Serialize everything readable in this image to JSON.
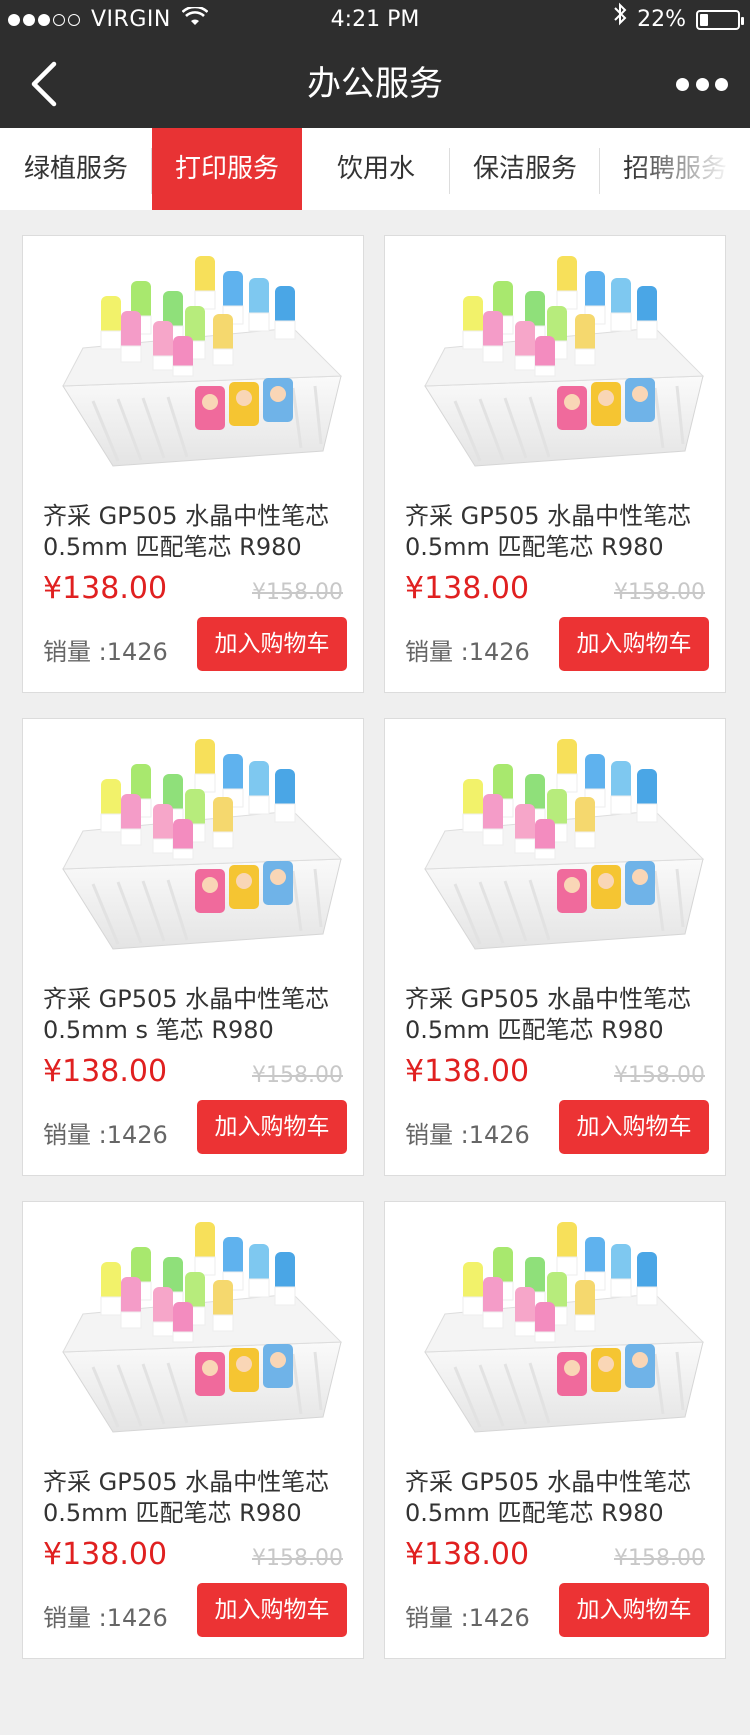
{
  "status_bar": {
    "carrier": "VIRGIN",
    "time": "4:21 PM",
    "battery": "22%",
    "battery_level": 0.22,
    "icons": [
      "signal-dots-icon",
      "wifi-icon",
      "bluetooth-icon",
      "battery-icon"
    ]
  },
  "nav": {
    "title": "办公服务",
    "back_icon": "chevron-left-icon",
    "more_icon": "more-dots-icon"
  },
  "tabs": [
    {
      "label": "绿植服务",
      "active": false
    },
    {
      "label": "打印服务",
      "active": true
    },
    {
      "label": "饮用水",
      "active": false
    },
    {
      "label": "保洁服务",
      "active": false
    },
    {
      "label": "招聘服务",
      "active": false
    }
  ],
  "colors": {
    "nav_bg": "#2e2e2e",
    "accent": "#e83334",
    "price": "#e02020",
    "page_bg": "#efefef"
  },
  "products": [
    {
      "name": "齐采 GP505 水晶中性笔芯 0.5mm 匹配笔芯 R980",
      "price": "¥138.00",
      "original_price": "¥158.00",
      "sales": "销量 :1426",
      "button": "加入购物车"
    },
    {
      "name": "齐采 GP505 水晶中性笔芯 0.5mm 匹配笔芯 R980",
      "price": "¥138.00",
      "original_price": "¥158.00",
      "sales": "销量 :1426",
      "button": "加入购物车"
    },
    {
      "name": "齐采 GP505 水晶中性笔芯 0.5mm s 笔芯 R980",
      "price": "¥138.00",
      "original_price": "¥158.00",
      "sales": "销量 :1426",
      "button": "加入购物车"
    },
    {
      "name": "齐采 GP505 水晶中性笔芯 0.5mm 匹配笔芯 R980",
      "price": "¥138.00",
      "original_price": "¥158.00",
      "sales": "销量 :1426",
      "button": "加入购物车"
    },
    {
      "name": "齐采 GP505 水晶中性笔芯 0.5mm 匹配笔芯 R980",
      "price": "¥138.00",
      "original_price": "¥158.00",
      "sales": "销量 :1426",
      "button": "加入购物车"
    },
    {
      "name": "齐采 GP505 水晶中性笔芯 0.5mm 匹配笔芯 R980",
      "price": "¥138.00",
      "original_price": "¥158.00",
      "sales": "销量 :1426",
      "button": "加入购物车"
    }
  ]
}
